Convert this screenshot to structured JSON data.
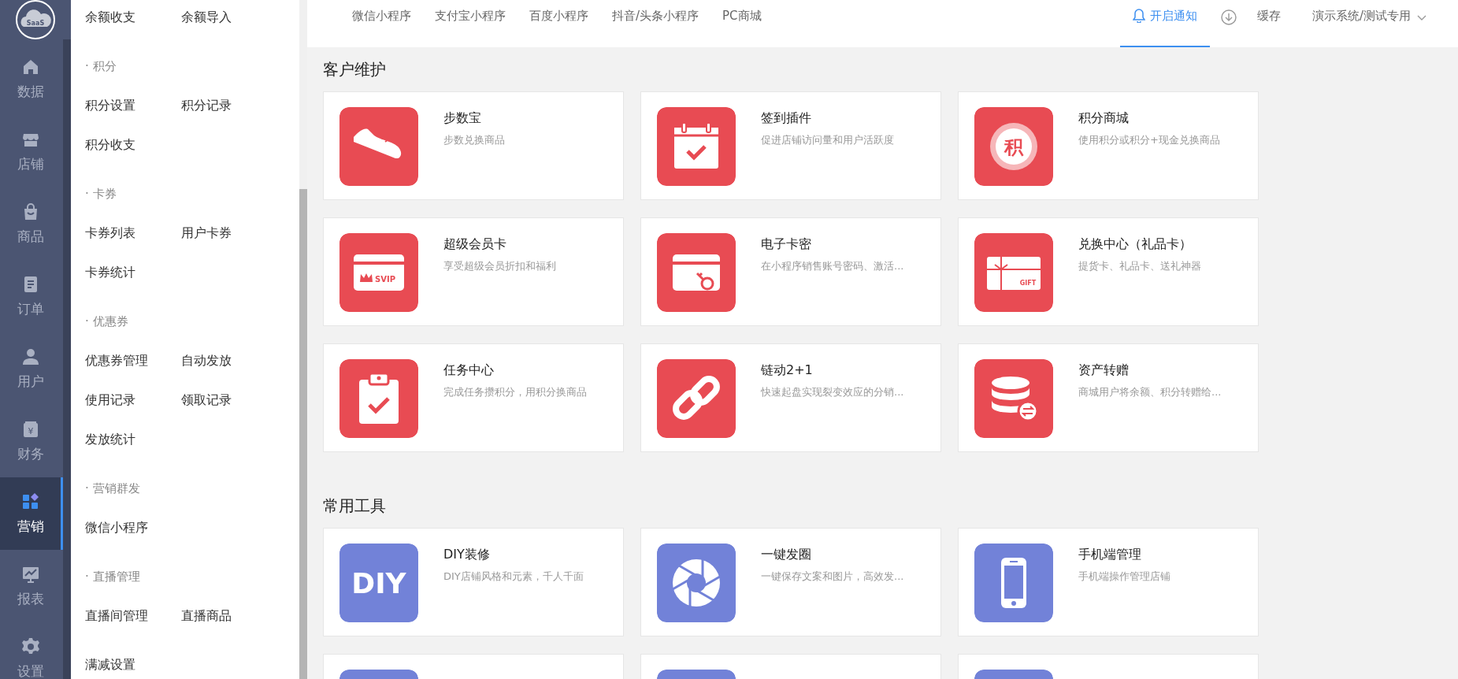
{
  "rail": {
    "logo_text": "SaaS",
    "items": [
      {
        "label": "数据",
        "selected": false
      },
      {
        "label": "店铺",
        "selected": false
      },
      {
        "label": "商品",
        "selected": false
      },
      {
        "label": "订单",
        "selected": false
      },
      {
        "label": "用户",
        "selected": false
      },
      {
        "label": "财务",
        "selected": false,
        "icon_text": "¥"
      },
      {
        "label": "营销",
        "selected": true
      },
      {
        "label": "报表",
        "selected": false
      },
      {
        "label": "设置",
        "selected": false
      }
    ]
  },
  "submenu": {
    "groups": [
      {
        "items": [
          "余额收支",
          "余额导入"
        ]
      },
      {
        "title": "· 积分",
        "items": [
          "积分设置",
          "积分记录",
          "积分收支"
        ]
      },
      {
        "title": "· 卡券",
        "items": [
          "卡券列表",
          "用户卡券",
          "卡券统计"
        ]
      },
      {
        "title": "· 优惠券",
        "items": [
          "优惠券管理",
          "自动发放",
          "使用记录",
          "领取记录",
          "发放统计"
        ]
      },
      {
        "title": "· 营销群发",
        "items": [
          "微信小程序"
        ]
      },
      {
        "title": "· 直播管理",
        "items": [
          "直播间管理",
          "直播商品"
        ]
      },
      {
        "items": [
          "满减设置"
        ]
      }
    ]
  },
  "top_nav": {
    "tabs": [
      "微信小程序",
      "支付宝小程序",
      "百度小程序",
      "抖音/头条小程序",
      "PC商城"
    ],
    "notify": {
      "label": "开启通知",
      "selected": true
    },
    "cache": "缓存",
    "account": "演示系统/测试专用"
  },
  "sections": [
    {
      "title": "客户维护",
      "color": "#e84b53",
      "cards": [
        {
          "kind": "full",
          "title": "步数宝",
          "desc": "步数兑换商品"
        },
        {
          "kind": "full",
          "title": "签到插件",
          "desc": "促进店铺访问量和用户活跃度"
        },
        {
          "kind": "full",
          "title": "积分商城",
          "desc": "使用积分或积分+现金兑换商品",
          "icon_text": "积"
        },
        {
          "kind": "full",
          "title": "超级会员卡",
          "desc": "享受超级会员折扣和福利",
          "icon_text": "SVIP"
        },
        {
          "kind": "full",
          "title": "电子卡密",
          "desc": "在小程序销售账号密码、激活..."
        },
        {
          "kind": "full",
          "title": "兑换中心（礼品卡）",
          "desc": "提货卡、礼品卡、送礼神器",
          "icon_text": "GIFT"
        },
        {
          "kind": "full",
          "title": "任务中心",
          "desc": "完成任务攒积分，用积分换商品"
        },
        {
          "kind": "full",
          "title": "链动2+1",
          "desc": "快速起盘实现裂变效应的分销..."
        },
        {
          "kind": "full",
          "title": "资产转赠",
          "desc": "商城用户将余额、积分转赠给..."
        }
      ]
    },
    {
      "title": "常用工具",
      "color": "#7282d8",
      "cards": [
        {
          "kind": "full",
          "title": "DIY装修",
          "desc": "DIY店铺风格和元素，千人千面",
          "icon_text": "DIY"
        },
        {
          "kind": "full",
          "title": "一键发圈",
          "desc": "一键保存文案和图片，高效发..."
        },
        {
          "kind": "full",
          "title": "手机端管理",
          "desc": "手机端操作管理店铺"
        },
        {
          "kind": "cut"
        },
        {
          "kind": "cut"
        },
        {
          "kind": "cut"
        }
      ]
    }
  ]
}
